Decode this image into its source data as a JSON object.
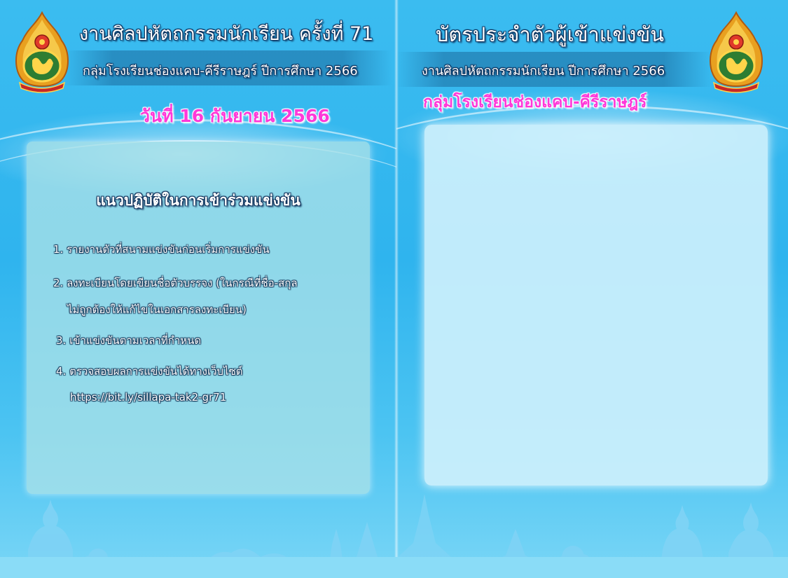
{
  "left_page": {
    "event_title": "งานศิลปหัตถกรรมนักเรียน ครั้งที่ 71",
    "group_line": "กลุ่มโรงเรียนช่องแคบ-คีรีราษฎร์ ปีการศึกษา 2566",
    "date": "วันที่ 16 กันยายน 2566",
    "rules_title": "แนวปฏิบัติในการเข้าร่วมแข่งขัน",
    "rules": [
      "1. รายงานตัวที่สนามแข่งขันก่อนเริ่มการแข่งขัน",
      "2. ลงทะเบียนโดยเขียนชื่อตัวบรรจง (ในกรณีที่ชื่อ-สกุล",
      "ไม่ถูกต้องให้แก้ไขในเอกสารลงทะเบียน)",
      "3. เข้าแข่งขันตามเวลาที่กำหนด",
      "4. ตรวจสอบผลการแข่งขันได้ทางเว็บไซต์",
      "https://bit.ly/sillapa-tak2-gr71"
    ]
  },
  "right_page": {
    "card_title": "บัตรประจำตัวผู้เข้าแข่งขัน",
    "event_line": "งานศิลปหัตถกรรมนักเรียน ปีการศึกษา 2566",
    "group_name": "กลุ่มโรงเรียนช่องแคบ-คีรีราษฎร์"
  },
  "icons": {
    "left_emblem": "obec-emblem-icon",
    "right_emblem": "obec-emblem-icon"
  },
  "colors": {
    "background": "#2fb4ee",
    "title_text": "#ffffff",
    "accent_pink": "#ff38d8",
    "panel": "#aae1e8",
    "photo_panel": "#cdf0fc"
  }
}
